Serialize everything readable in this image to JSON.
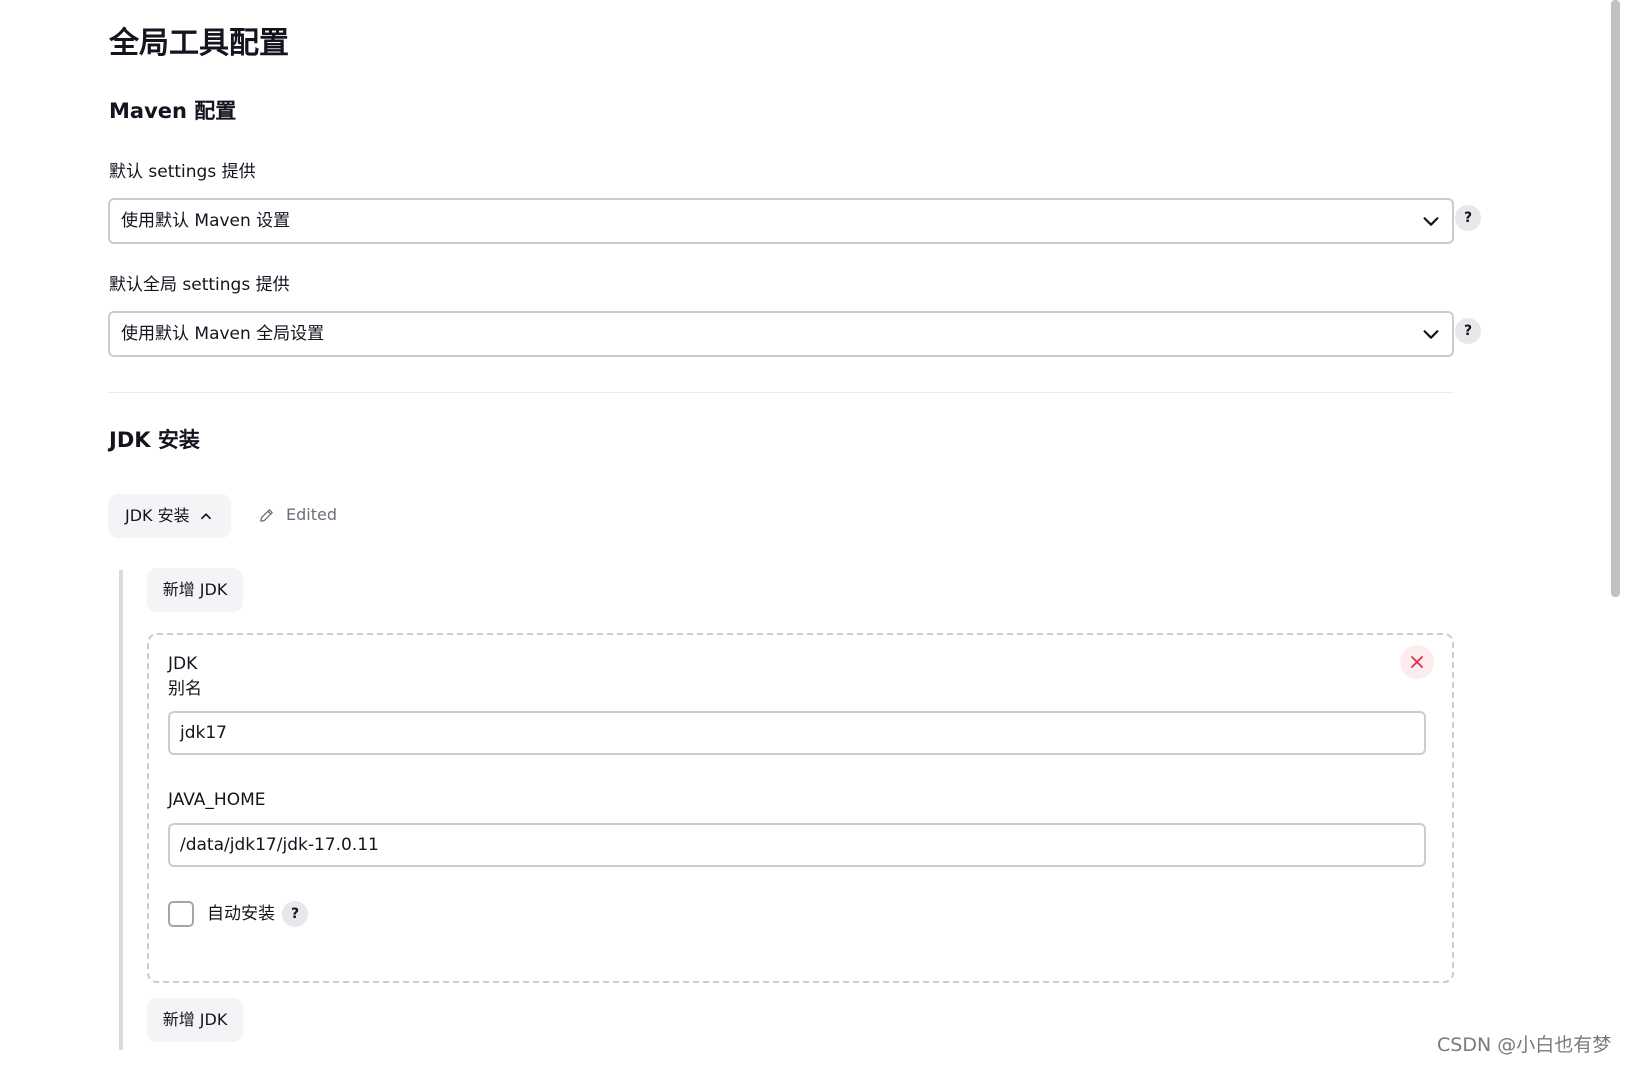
{
  "page": {
    "title": "全局工具配置"
  },
  "maven": {
    "heading": "Maven 配置",
    "settings": {
      "label": "默认 settings 提供",
      "selected": "使用默认 Maven 设置",
      "help": "?"
    },
    "global_settings": {
      "label": "默认全局 settings 提供",
      "selected": "使用默认 Maven 全局设置",
      "help": "?"
    }
  },
  "jdk": {
    "heading": "JDK 安装",
    "toggle_label": "JDK 安装",
    "edited_label": "Edited",
    "add_button_label": "新增 JDK",
    "item": {
      "type_label": "JDK",
      "name_label": "别名",
      "name_value": "jdk17",
      "java_home_label": "JAVA_HOME",
      "java_home_value": "/data/jdk17/jdk-17.0.11",
      "auto_install_label": "自动安装",
      "auto_install_checked": false,
      "help": "?"
    }
  },
  "watermark": "CSDN @小白也有梦",
  "colors": {
    "border": "#c9ccd3",
    "button_bg": "#f3f4f6",
    "delete_icon": "#e0304e",
    "help_bg": "#e8e8ec"
  }
}
